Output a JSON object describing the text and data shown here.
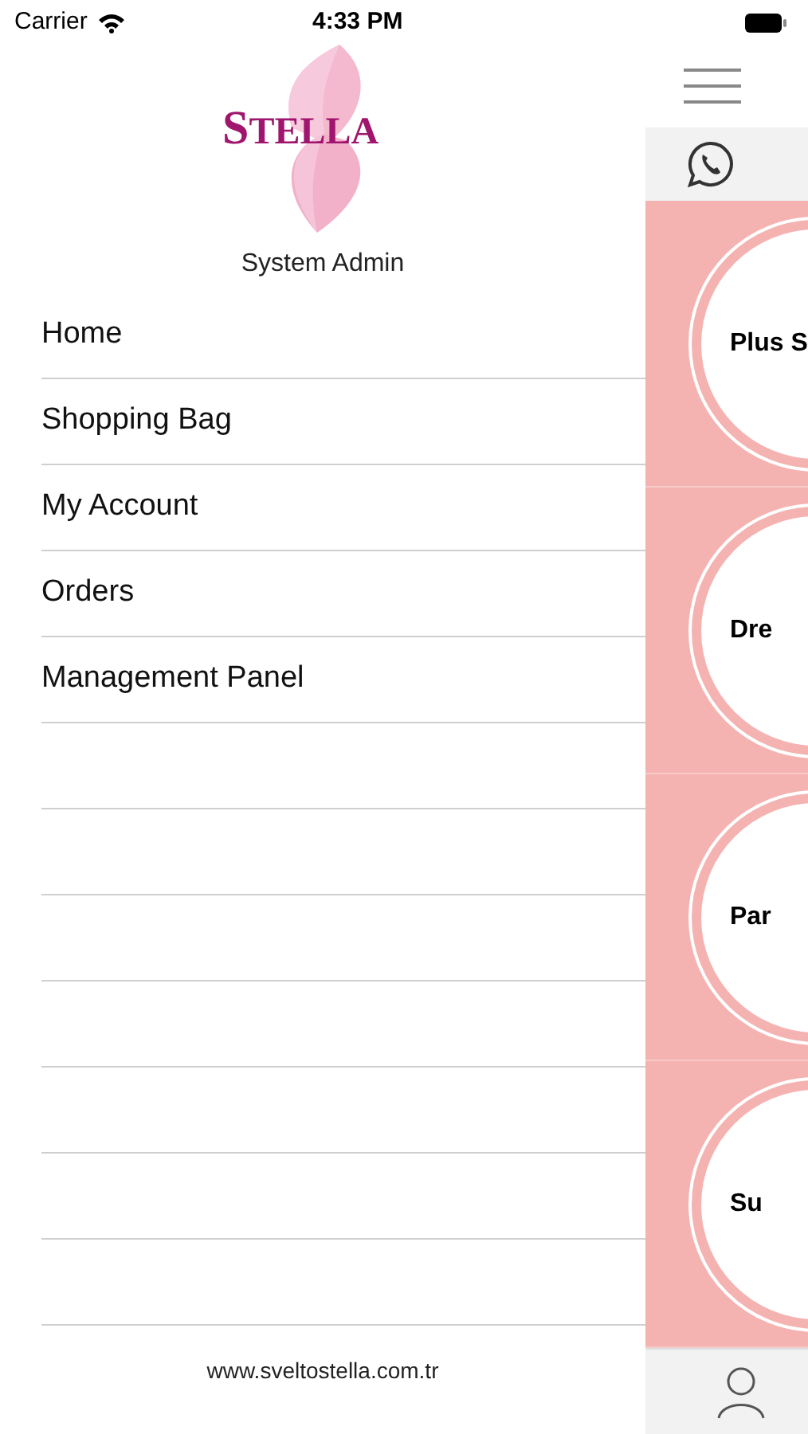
{
  "status_bar": {
    "carrier": "Carrier",
    "time": "4:33 PM"
  },
  "drawer": {
    "logo": "STELLA",
    "user": "System Admin",
    "items": [
      {
        "label": "Home"
      },
      {
        "label": "Shopping Bag"
      },
      {
        "label": "My Account"
      },
      {
        "label": "Orders"
      },
      {
        "label": "Management Panel"
      }
    ],
    "footer": "www.sveltostella.com.tr"
  },
  "categories": [
    {
      "label": "Plus S"
    },
    {
      "label": "Dre"
    },
    {
      "label": "Par"
    },
    {
      "label": "Su"
    }
  ]
}
